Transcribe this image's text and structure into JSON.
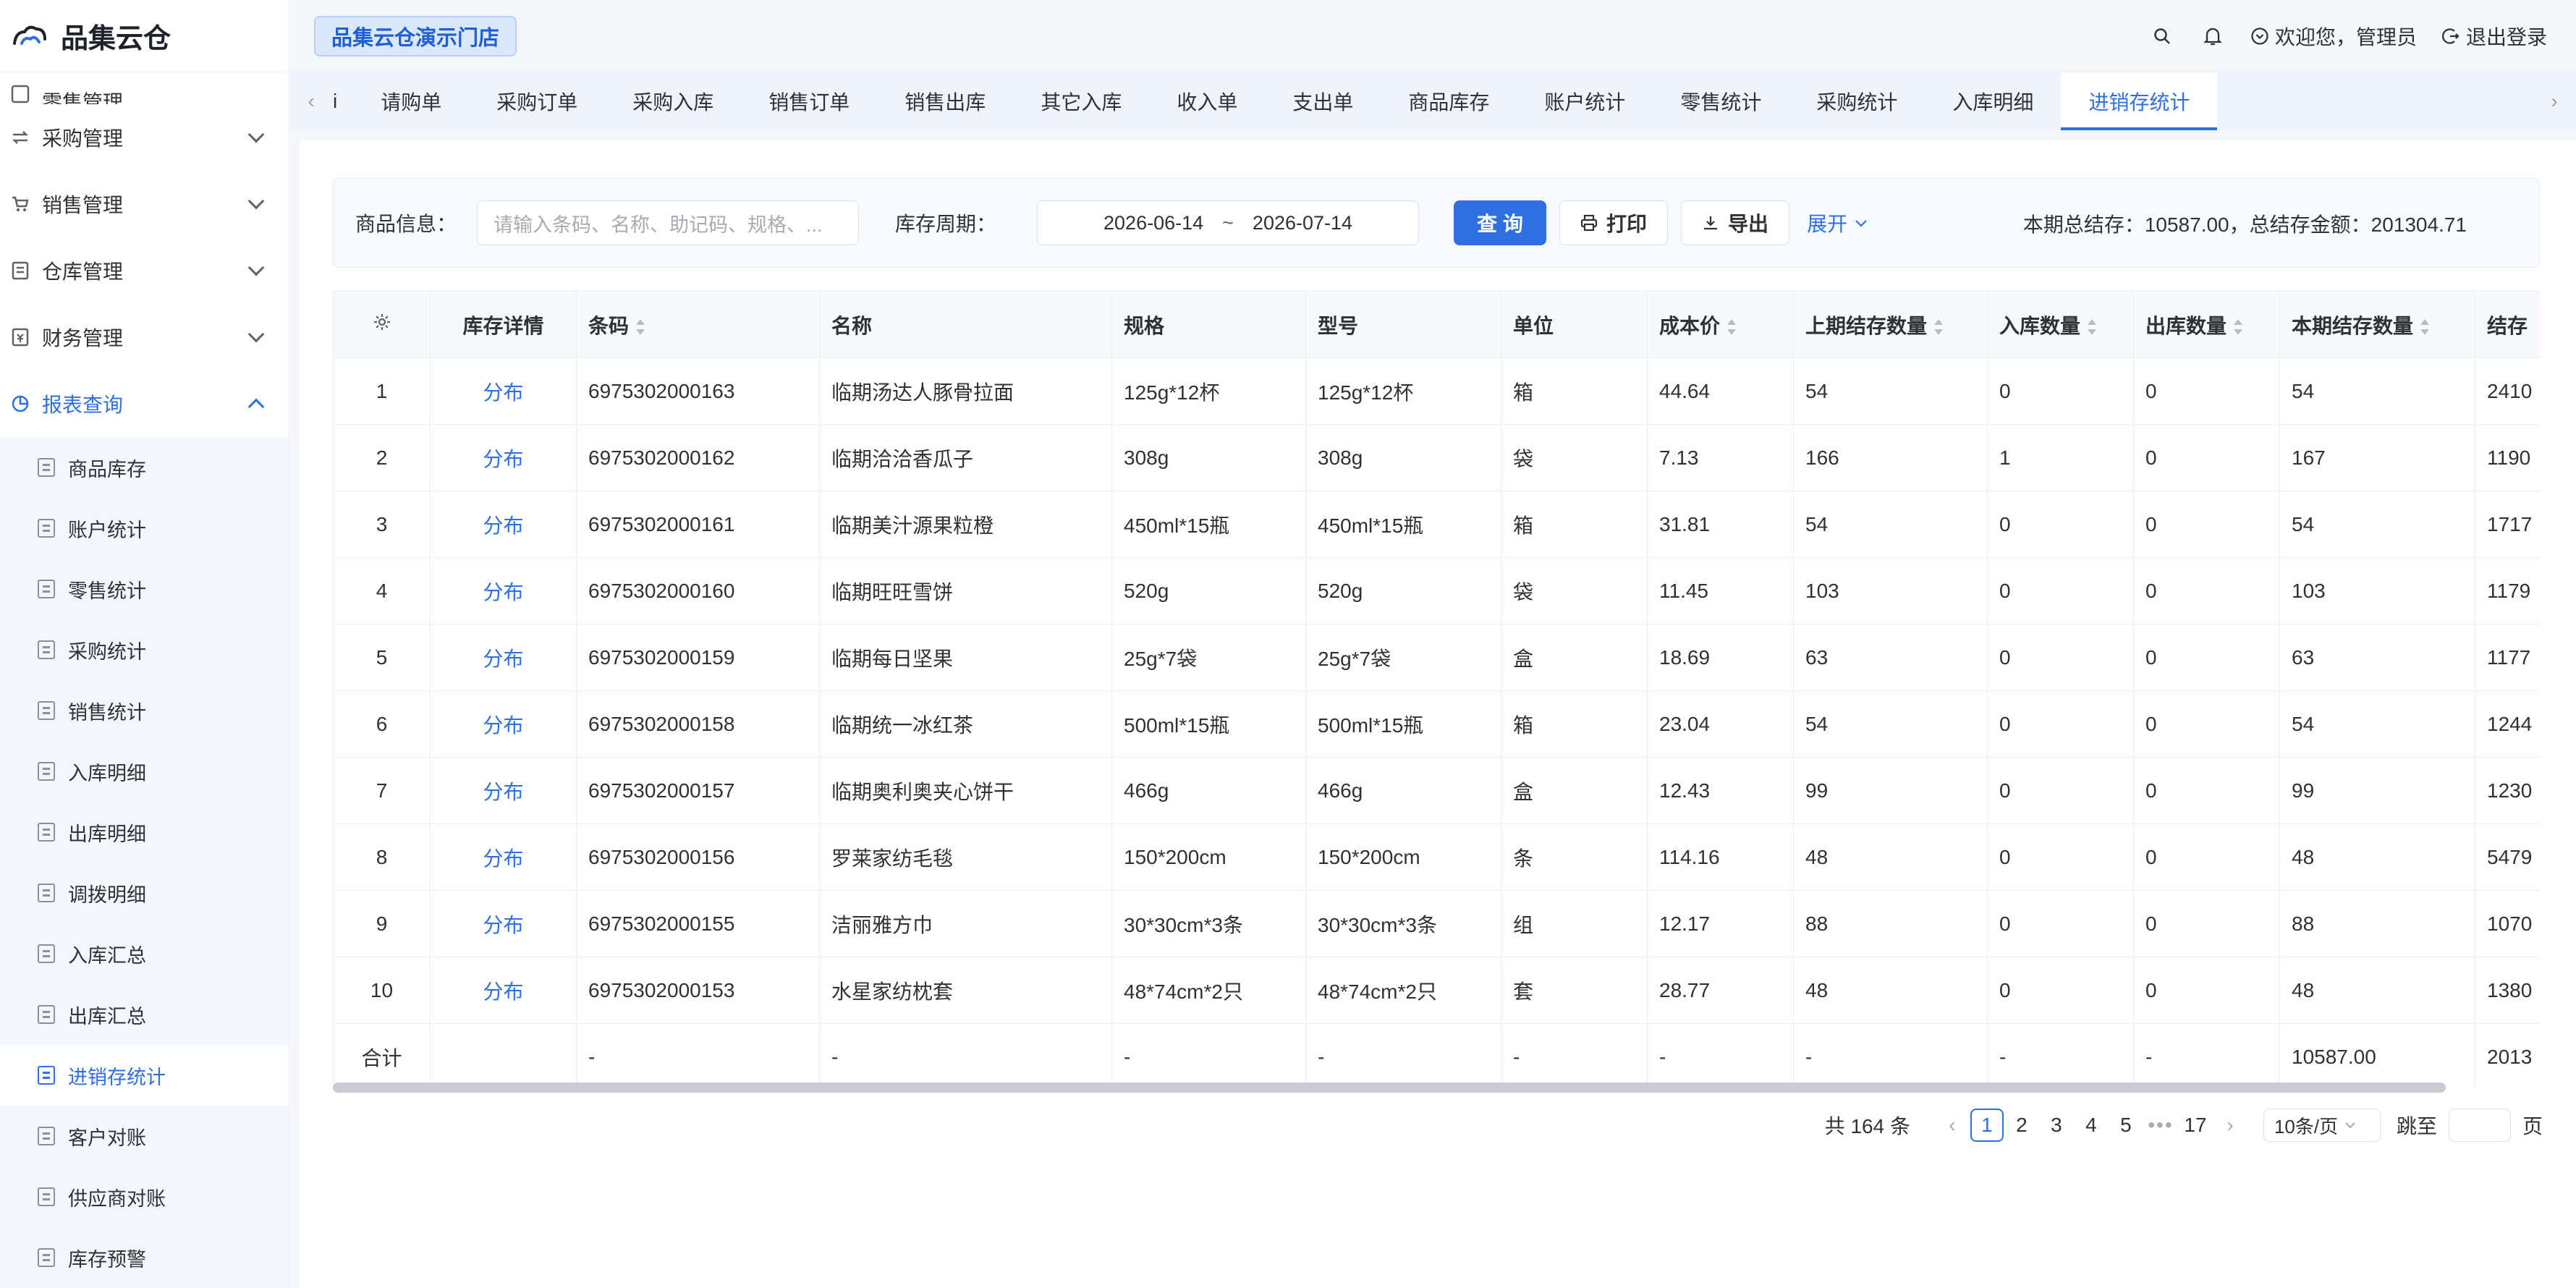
{
  "app": {
    "name": "品集云仓"
  },
  "header": {
    "store": "品集云仓演示门店",
    "welcome": "欢迎您，管理员",
    "logout": "退出登录"
  },
  "sidebar": {
    "top_partial": "零售管理",
    "groups": [
      {
        "label": "采购管理"
      },
      {
        "label": "销售管理"
      },
      {
        "label": "仓库管理"
      },
      {
        "label": "财务管理"
      },
      {
        "label": "报表查询"
      }
    ],
    "report_items": [
      "商品库存",
      "账户统计",
      "零售统计",
      "采购统计",
      "销售统计",
      "入库明细",
      "出库明细",
      "调拨明细",
      "入库汇总",
      "出库汇总",
      "进销存统计",
      "客户对账",
      "供应商对账",
      "库存预警"
    ],
    "active_item": "进销存统计"
  },
  "tabs": {
    "first_partial": "i",
    "items": [
      "请购单",
      "采购订单",
      "采购入库",
      "销售订单",
      "销售出库",
      "其它入库",
      "收入单",
      "支出单",
      "商品库存",
      "账户统计",
      "零售统计",
      "采购统计",
      "入库明细",
      "进销存统计"
    ],
    "active": "进销存统计"
  },
  "filter": {
    "product_label": "商品信息：",
    "product_placeholder": "请输入条码、名称、助记码、规格、...",
    "period_label": "库存周期：",
    "date_start": "2026-06-14",
    "date_sep": "~",
    "date_end": "2026-07-14",
    "query": "查 询",
    "print": "打印",
    "export": "导出",
    "expand": "展开",
    "summary": "本期总结存：10587.00，总结存金额：201304.71"
  },
  "table": {
    "columns": [
      "",
      "库存详情",
      "条码",
      "名称",
      "规格",
      "型号",
      "单位",
      "成本价",
      "上期结存数量",
      "入库数量",
      "出库数量",
      "本期结存数量",
      "结存"
    ],
    "rows": [
      [
        "1",
        "分布",
        "6975302000163",
        "临期汤达人豚骨拉面",
        "125g*12杯",
        "125g*12杯",
        "箱",
        "44.64",
        "54",
        "0",
        "0",
        "54",
        "2410"
      ],
      [
        "2",
        "分布",
        "6975302000162",
        "临期洽洽香瓜子",
        "308g",
        "308g",
        "袋",
        "7.13",
        "166",
        "1",
        "0",
        "167",
        "1190"
      ],
      [
        "3",
        "分布",
        "6975302000161",
        "临期美汁源果粒橙",
        "450ml*15瓶",
        "450ml*15瓶",
        "箱",
        "31.81",
        "54",
        "0",
        "0",
        "54",
        "1717"
      ],
      [
        "4",
        "分布",
        "6975302000160",
        "临期旺旺雪饼",
        "520g",
        "520g",
        "袋",
        "11.45",
        "103",
        "0",
        "0",
        "103",
        "1179"
      ],
      [
        "5",
        "分布",
        "6975302000159",
        "临期每日坚果",
        "25g*7袋",
        "25g*7袋",
        "盒",
        "18.69",
        "63",
        "0",
        "0",
        "63",
        "1177"
      ],
      [
        "6",
        "分布",
        "6975302000158",
        "临期统一冰红茶",
        "500ml*15瓶",
        "500ml*15瓶",
        "箱",
        "23.04",
        "54",
        "0",
        "0",
        "54",
        "1244"
      ],
      [
        "7",
        "分布",
        "6975302000157",
        "临期奥利奥夹心饼干",
        "466g",
        "466g",
        "盒",
        "12.43",
        "99",
        "0",
        "0",
        "99",
        "1230"
      ],
      [
        "8",
        "分布",
        "6975302000156",
        "罗莱家纺毛毯",
        "150*200cm",
        "150*200cm",
        "条",
        "114.16",
        "48",
        "0",
        "0",
        "48",
        "5479"
      ],
      [
        "9",
        "分布",
        "6975302000155",
        "洁丽雅方巾",
        "30*30cm*3条",
        "30*30cm*3条",
        "组",
        "12.17",
        "88",
        "0",
        "0",
        "88",
        "1070"
      ],
      [
        "10",
        "分布",
        "6975302000153",
        "水星家纺枕套",
        "48*74cm*2只",
        "48*74cm*2只",
        "套",
        "28.77",
        "48",
        "0",
        "0",
        "48",
        "1380"
      ]
    ],
    "total_row": [
      "合计",
      "",
      "-",
      "-",
      "-",
      "-",
      "-",
      "-",
      "-",
      "-",
      "-",
      "10587.00",
      "2013"
    ]
  },
  "pager": {
    "total": "共 164 条",
    "pages": [
      "1",
      "2",
      "3",
      "4",
      "5",
      "•••",
      "17"
    ],
    "current": "1",
    "page_size": "10条/页",
    "jump_label": "跳至",
    "jump_suffix": "页"
  }
}
